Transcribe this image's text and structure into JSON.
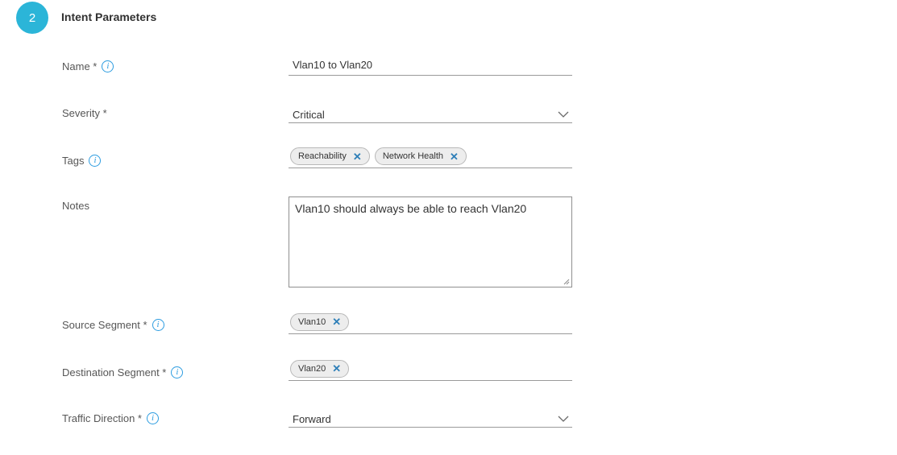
{
  "section": {
    "step_number": "2",
    "title": "Intent Parameters"
  },
  "fields": {
    "name": {
      "label": "Name *",
      "value": "Vlan10 to Vlan20"
    },
    "severity": {
      "label": "Severity *",
      "value": "Critical"
    },
    "tags": {
      "label": "Tags",
      "items": [
        "Reachability",
        "Network Health"
      ]
    },
    "notes": {
      "label": "Notes",
      "value": "Vlan10 should always be able to reach Vlan20"
    },
    "source_segment": {
      "label": "Source Segment *",
      "items": [
        "Vlan10"
      ]
    },
    "destination_segment": {
      "label": "Destination Segment *",
      "items": [
        "Vlan20"
      ]
    },
    "traffic_direction": {
      "label": "Traffic Direction *",
      "value": "Forward"
    }
  },
  "icons": {
    "info": "i",
    "remove": "✕"
  },
  "colors": {
    "accent": "#2bb5d8",
    "info_icon": "#2c9ce0",
    "tag_close": "#2e7fb8"
  }
}
